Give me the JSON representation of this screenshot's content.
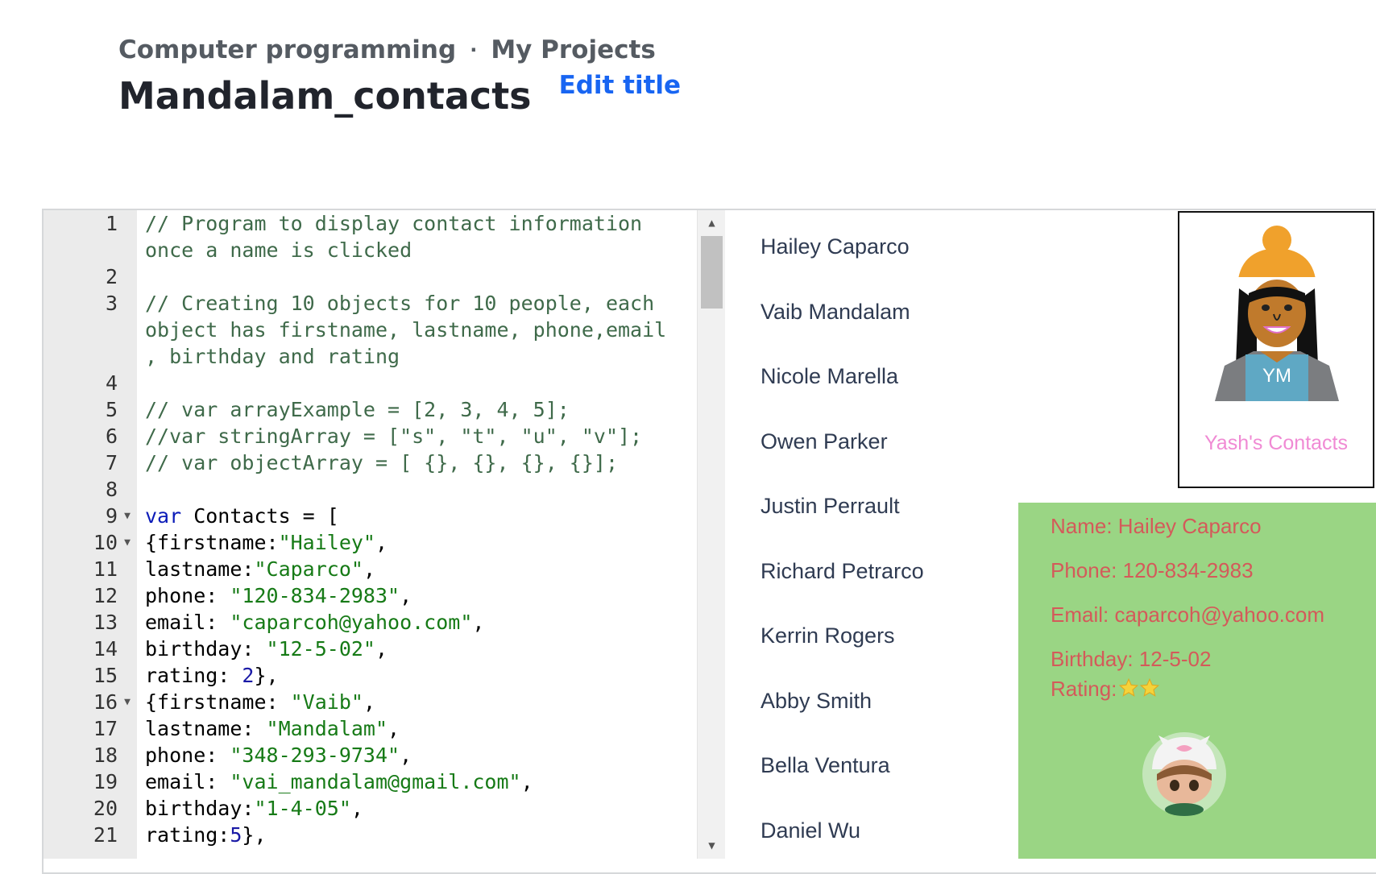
{
  "breadcrumb": {
    "parent": "Computer programming",
    "separator": "·",
    "current": "My Projects"
  },
  "project": {
    "title": "Mandalam_contacts",
    "edit_label": "Edit title"
  },
  "editor": {
    "lines": [
      {
        "n": "1",
        "fold": "",
        "parts": [
          {
            "t": "// Program to display contact information\nonce a name is clicked",
            "c": "comment"
          }
        ]
      },
      {
        "n": "2",
        "fold": "",
        "parts": []
      },
      {
        "n": "3",
        "fold": "",
        "parts": [
          {
            "t": "// Creating 10 objects for 10 people, each\nobject has firstname, lastname, phone,email\n, birthday and rating",
            "c": "comment"
          }
        ]
      },
      {
        "n": "4",
        "fold": "",
        "parts": []
      },
      {
        "n": "5",
        "fold": "",
        "parts": [
          {
            "t": "// var arrayExample = [2, 3, 4, 5];",
            "c": "comment"
          }
        ]
      },
      {
        "n": "6",
        "fold": "",
        "parts": [
          {
            "t": "//var stringArray = [\"s\", \"t\", \"u\", \"v\"];",
            "c": "comment"
          }
        ]
      },
      {
        "n": "7",
        "fold": "",
        "parts": [
          {
            "t": "// var objectArray = [ {}, {}, {}, {}];",
            "c": "comment"
          }
        ]
      },
      {
        "n": "8",
        "fold": "",
        "parts": []
      },
      {
        "n": "9",
        "fold": "▼",
        "parts": [
          {
            "t": "var",
            "c": "kw"
          },
          {
            "t": " Contacts = [",
            "c": "plain"
          }
        ]
      },
      {
        "n": "10",
        "fold": "▼",
        "parts": [
          {
            "t": "{firstname:",
            "c": "plain"
          },
          {
            "t": "\"Hailey\"",
            "c": "str"
          },
          {
            "t": ",",
            "c": "plain"
          }
        ]
      },
      {
        "n": "11",
        "fold": "",
        "parts": [
          {
            "t": "lastname:",
            "c": "plain"
          },
          {
            "t": "\"Caparco\"",
            "c": "str"
          },
          {
            "t": ",",
            "c": "plain"
          }
        ]
      },
      {
        "n": "12",
        "fold": "",
        "parts": [
          {
            "t": "phone: ",
            "c": "plain"
          },
          {
            "t": "\"120-834-2983\"",
            "c": "str"
          },
          {
            "t": ",",
            "c": "plain"
          }
        ]
      },
      {
        "n": "13",
        "fold": "",
        "parts": [
          {
            "t": "email: ",
            "c": "plain"
          },
          {
            "t": "\"caparcoh@yahoo.com\"",
            "c": "str"
          },
          {
            "t": ",",
            "c": "plain"
          }
        ]
      },
      {
        "n": "14",
        "fold": "",
        "parts": [
          {
            "t": "birthday: ",
            "c": "plain"
          },
          {
            "t": "\"12-5-02\"",
            "c": "str"
          },
          {
            "t": ",",
            "c": "plain"
          }
        ]
      },
      {
        "n": "15",
        "fold": "",
        "parts": [
          {
            "t": "rating: ",
            "c": "plain"
          },
          {
            "t": "2",
            "c": "num"
          },
          {
            "t": "},",
            "c": "plain"
          }
        ]
      },
      {
        "n": "16",
        "fold": "▼",
        "parts": [
          {
            "t": "{firstname: ",
            "c": "plain"
          },
          {
            "t": "\"Vaib\"",
            "c": "str"
          },
          {
            "t": ",",
            "c": "plain"
          }
        ]
      },
      {
        "n": "17",
        "fold": "",
        "parts": [
          {
            "t": "lastname: ",
            "c": "plain"
          },
          {
            "t": "\"Mandalam\"",
            "c": "str"
          },
          {
            "t": ",",
            "c": "plain"
          }
        ]
      },
      {
        "n": "18",
        "fold": "",
        "parts": [
          {
            "t": "phone: ",
            "c": "plain"
          },
          {
            "t": "\"348-293-9734\"",
            "c": "str"
          },
          {
            "t": ",",
            "c": "plain"
          }
        ]
      },
      {
        "n": "19",
        "fold": "",
        "parts": [
          {
            "t": "email: ",
            "c": "plain"
          },
          {
            "t": "\"vai_mandalam@gmail.com\"",
            "c": "str"
          },
          {
            "t": ",",
            "c": "plain"
          }
        ]
      },
      {
        "n": "20",
        "fold": "",
        "parts": [
          {
            "t": "birthday:",
            "c": "plain"
          },
          {
            "t": "\"1-4-05\"",
            "c": "str"
          },
          {
            "t": ",",
            "c": "plain"
          }
        ]
      },
      {
        "n": "21",
        "fold": "",
        "parts": [
          {
            "t": "rating:",
            "c": "plain"
          },
          {
            "t": "5",
            "c": "num"
          },
          {
            "t": "},",
            "c": "plain"
          }
        ]
      }
    ]
  },
  "output": {
    "names": [
      "Hailey Caparco",
      "Vaib Mandalam",
      "Nicole Marella",
      "Owen Parker",
      "Justin Perrault",
      "Richard Petrarco",
      "Kerrin Rogers",
      "Abby Smith",
      "Bella Ventura",
      "Daniel Wu"
    ],
    "logo": {
      "shirt_text": "YM",
      "caption": "Yash's Contacts"
    },
    "details": {
      "name": "Name: Hailey Caparco",
      "phone": "Phone: 120-834-2983",
      "email": "Email: caparcoh@yahoo.com",
      "birthday": "Birthday: 12-5-02",
      "rating_label": "Rating:",
      "rating_value": 2
    }
  },
  "colors": {
    "link": "#1865f2",
    "details_bg": "#9ad584",
    "details_text": "#d45a5a",
    "caption": "#f08ad4"
  }
}
